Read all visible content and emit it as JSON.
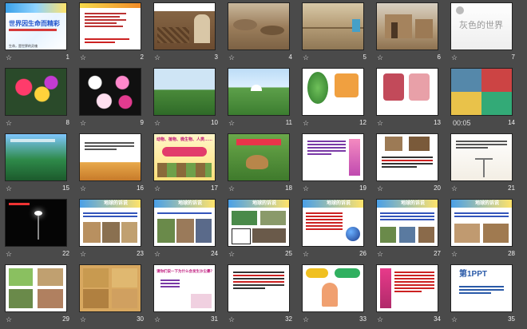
{
  "slides": [
    {
      "n": "1",
      "title": "世界因生命而精彩",
      "sub": "生命，是世界的灵魂"
    },
    {
      "n": "2",
      "title": ""
    },
    {
      "n": "3",
      "title": ""
    },
    {
      "n": "4",
      "title": ""
    },
    {
      "n": "5",
      "title": ""
    },
    {
      "n": "6",
      "title": ""
    },
    {
      "n": "7",
      "title": "灰色的世界"
    },
    {
      "n": "8",
      "title": ""
    },
    {
      "n": "9",
      "title": ""
    },
    {
      "n": "10",
      "title": ""
    },
    {
      "n": "11",
      "title": ""
    },
    {
      "n": "12",
      "title": ""
    },
    {
      "n": "13",
      "title": ""
    },
    {
      "n": "00:05",
      "title": "",
      "time": "14"
    },
    {
      "n": "15",
      "title": ""
    },
    {
      "n": "16",
      "title": ""
    },
    {
      "n": "17",
      "title": "动物、植物、微生物、人类……"
    },
    {
      "n": "18",
      "title": ""
    },
    {
      "n": "19",
      "title": ""
    },
    {
      "n": "20",
      "title": ""
    },
    {
      "n": "21",
      "title": ""
    },
    {
      "n": "22",
      "title": ""
    },
    {
      "n": "23",
      "title": "地球的诉说"
    },
    {
      "n": "24",
      "title": "地球的诉说"
    },
    {
      "n": "25",
      "title": "地球的诉说"
    },
    {
      "n": "26",
      "title": "地球的诉说"
    },
    {
      "n": "27",
      "title": "地球的诉说"
    },
    {
      "n": "28",
      "title": "地球的诉说"
    },
    {
      "n": "29",
      "title": ""
    },
    {
      "n": "30",
      "title": ""
    },
    {
      "n": "31",
      "title": "请你们说一下为什么会发生沙尘暴？"
    },
    {
      "n": "32",
      "title": ""
    },
    {
      "n": "33",
      "title": ""
    },
    {
      "n": "34",
      "title": ""
    },
    {
      "n": "35",
      "title": "第1PPT"
    }
  ],
  "star_glyph": "☆"
}
